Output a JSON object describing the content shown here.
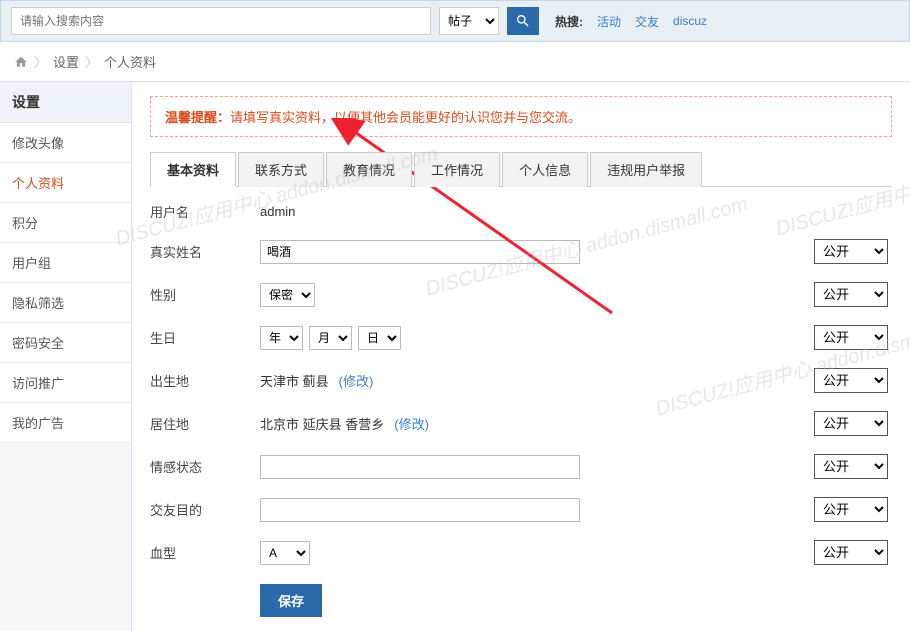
{
  "search": {
    "placeholder": "请输入搜索内容",
    "select_label": "帖子",
    "hot_label": "热搜:",
    "hot_links": [
      "活动",
      "交友",
      "discuz"
    ]
  },
  "breadcrumb": {
    "a": "设置",
    "b": "个人资料"
  },
  "sidebar": {
    "title": "设置",
    "items": [
      "修改头像",
      "个人资料",
      "积分",
      "用户组",
      "隐私筛选",
      "密码安全",
      "访问推广",
      "我的广告"
    ]
  },
  "notice": {
    "prefix": "温馨提醒：",
    "text": "请填写真实资料，以便其他会员能更好的认识您并与您交流。"
  },
  "tabs": [
    "基本资料",
    "联系方式",
    "教育情况",
    "工作情况",
    "个人信息",
    "违规用户举报"
  ],
  "priv_default": "公开",
  "form": {
    "username_label": "用户名",
    "username_value": "admin",
    "realname_label": "真实姓名",
    "realname_value": "喝酒",
    "gender_label": "性别",
    "gender_value": "保密",
    "birth_label": "生日",
    "birth_year": "年",
    "birth_month": "月",
    "birth_day": "日",
    "birthplace_label": "出生地",
    "birthplace_value": "天津市 蓟县",
    "residence_label": "居住地",
    "residence_value": "北京市 延庆县 香营乡",
    "modify": "(修改)",
    "emotion_label": "情感状态",
    "emotion_value": "",
    "purpose_label": "交友目的",
    "purpose_value": "",
    "blood_label": "血型",
    "blood_value": "A",
    "save": "保存"
  },
  "watermark": "DISCUZ!应用中心 addon.dismall.com"
}
